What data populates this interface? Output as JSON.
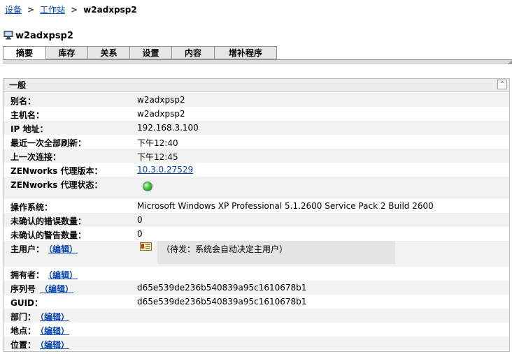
{
  "breadcrumb": {
    "item1": "设备",
    "item2": "工作站",
    "current": "w2adxpsp2",
    "sep": ">"
  },
  "page": {
    "title": "w2adxpsp2"
  },
  "tabs": [
    {
      "label": "摘要"
    },
    {
      "label": "库存"
    },
    {
      "label": "关系"
    },
    {
      "label": "设置"
    },
    {
      "label": "内容"
    },
    {
      "label": "增补程序"
    }
  ],
  "panel": {
    "title": "一般"
  },
  "fields": {
    "alias": {
      "label": "别名：",
      "value": "w2adxpsp2"
    },
    "hostname": {
      "label": "主机名：",
      "value": "w2adxpsp2"
    },
    "ip": {
      "label": "IP 地址：",
      "value": "192.168.3.100"
    },
    "last_refresh": {
      "label": "最近一次全部刷新：",
      "value": "下午12:40"
    },
    "last_contact": {
      "label": "上一次连接：",
      "value": "下午12:45"
    },
    "agent_version": {
      "label": "ZENworks 代理版本：",
      "value": "10.3.0.27529"
    },
    "agent_status": {
      "label": "ZENworks 代理状态：",
      "status_color": "#43c43f"
    },
    "os": {
      "label": "操作系统：",
      "value": "Microsoft Windows XP Professional 5.1.2600 Service Pack 2 Build 2600"
    },
    "errors": {
      "label": "未确认的错误数量：",
      "value": "0"
    },
    "warnings": {
      "label": "未确认的警告数量：",
      "value": "0"
    },
    "primary_user": {
      "label": "主用户：",
      "edit": "（编辑）",
      "value": "（待发：系统会自动决定主用户）"
    },
    "owner": {
      "label": "拥有者：",
      "edit": "（编辑）"
    },
    "serial": {
      "label": "序列号",
      "edit": "（编辑）",
      "value": "d65e539de236b540839a95c1610678b1"
    },
    "guid": {
      "label": "GUID：",
      "value": "d65e539de236b540839a95c1610678b1"
    },
    "department": {
      "label": "部门：",
      "edit": "（编辑）"
    },
    "site": {
      "label": "地点：",
      "edit": "（编辑）"
    },
    "location": {
      "label": "位置：",
      "edit": "（编辑）"
    }
  }
}
